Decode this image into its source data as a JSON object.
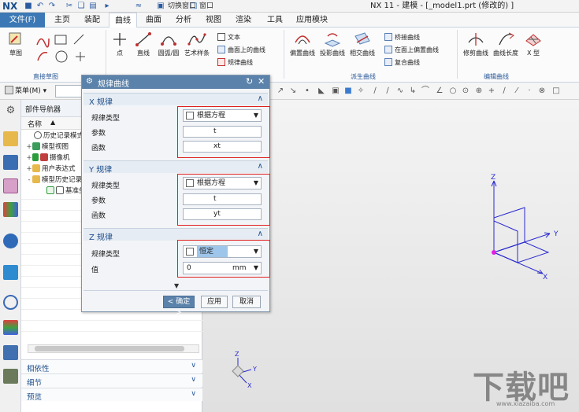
{
  "app": {
    "logo": "NX",
    "title": "NX 11 - 建模 - [_model1.prt  (修改的) ]",
    "switch_window": "切换窗口",
    "window_menu": "窗口"
  },
  "menu": {
    "file": "文件(F)",
    "tabs": [
      "主页",
      "装配",
      "曲线",
      "曲面",
      "分析",
      "视图",
      "渲染",
      "工具",
      "应用模块"
    ],
    "active_tab": "曲线"
  },
  "ribbon": {
    "sketch": "草图",
    "group_direct_sketch": "直接草图",
    "point": "点",
    "line": "直线",
    "arc_circle": "圆弧/圆",
    "art_spline": "艺术样条",
    "text": "文本",
    "curve_on_surface": "曲面上的曲线",
    "law_curve": "规律曲线",
    "offset_curve": "偏置曲线",
    "project_curve": "投影曲线",
    "intersect_curve": "相交曲线",
    "bridge_curve": "桥接曲线",
    "offset_on_face": "在面上偏置曲线",
    "composite_curve": "复合曲线",
    "group_derived": "派生曲线",
    "trim_curve": "修剪曲线",
    "curve_length": "曲线长度",
    "x_type": "X 型",
    "group_edit": "编辑曲线"
  },
  "toolbar2": {
    "menu": "菜单(M)"
  },
  "navigator": {
    "title": "部件导航器",
    "col_name": "名称",
    "items": [
      {
        "label": "历史记录模式",
        "level": 1
      },
      {
        "label": "模型视图",
        "level": 1
      },
      {
        "label": "摄像机",
        "level": 1
      },
      {
        "label": "用户表达式",
        "level": 1
      },
      {
        "label": "模型历史记录",
        "level": 1
      },
      {
        "label": "基准坐标系",
        "level": 2
      }
    ],
    "sections": [
      "相依性",
      "细节",
      "预览"
    ]
  },
  "dialog": {
    "title": "规律曲线",
    "x_section": "X 规律",
    "y_section": "Y 规律",
    "z_section": "Z 规律",
    "law_type_label": "规律类型",
    "param_label": "参数",
    "func_label": "函数",
    "value_label": "值",
    "x_law_type": "根据方程",
    "x_param": "t",
    "x_func": "xt",
    "y_law_type": "根据方程",
    "y_param": "t",
    "y_func": "yt",
    "z_law_type": "恒定",
    "z_value": "0",
    "z_unit": "mm",
    "ok": "< 确定 >",
    "apply": "应用",
    "cancel": "取消"
  },
  "graphics": {
    "axis_x": "X",
    "axis_y": "Y",
    "axis_z": "Z",
    "mini_x": "X",
    "mini_y": "Y",
    "mini_z": "Z"
  },
  "watermark": {
    "brand": "下载吧",
    "url": "www.xiazaiba.com"
  }
}
